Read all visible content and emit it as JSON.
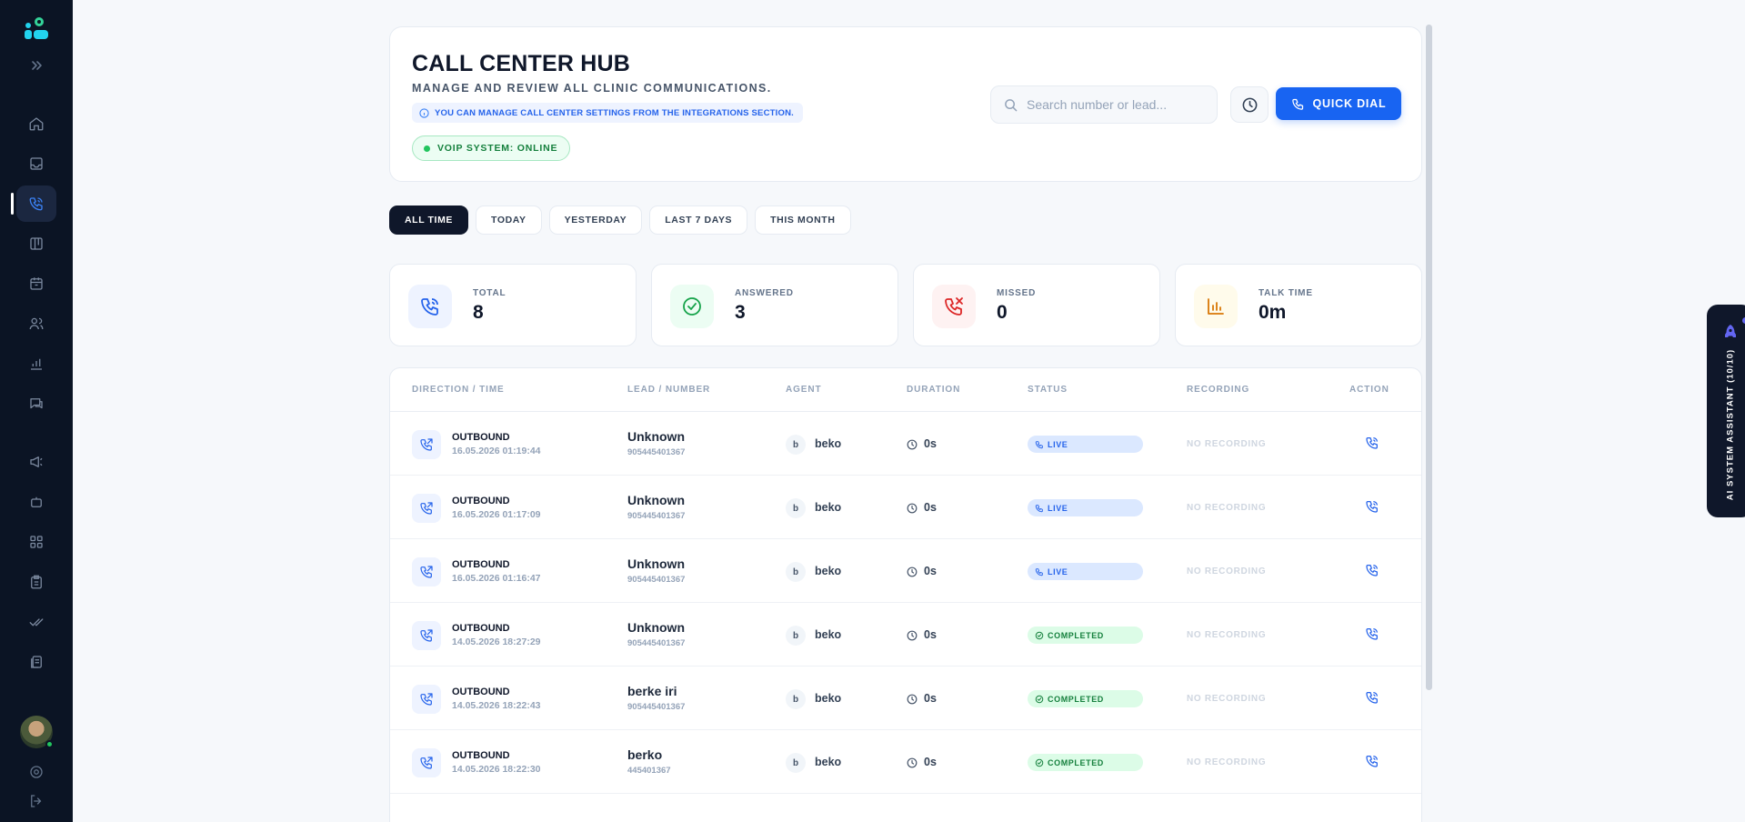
{
  "header": {
    "title": "CALL CENTER HUB",
    "subtitle": "MANAGE AND REVIEW ALL CLINIC COMMUNICATIONS.",
    "info": "YOU CAN MANAGE CALL CENTER SETTINGS FROM THE INTEGRATIONS SECTION.",
    "status": "VOIP SYSTEM: ONLINE",
    "search_placeholder": "Search number or lead...",
    "quick_dial": "QUICK DIAL"
  },
  "tabs": [
    "ALL TIME",
    "TODAY",
    "YESTERDAY",
    "LAST 7 DAYS",
    "THIS MONTH"
  ],
  "active_tab": "ALL TIME",
  "stats": [
    {
      "label": "TOTAL",
      "value": "8",
      "icon": "phone-call-icon",
      "color": "#2563eb"
    },
    {
      "label": "ANSWERED",
      "value": "3",
      "icon": "check-circle-icon",
      "color": "#16a34a"
    },
    {
      "label": "MISSED",
      "value": "0",
      "icon": "phone-missed-icon",
      "color": "#dc2626"
    },
    {
      "label": "TALK TIME",
      "value": "0m",
      "icon": "bar-chart-icon",
      "color": "#d97706"
    }
  ],
  "table": {
    "headers": [
      "DIRECTION / TIME",
      "LEAD / NUMBER",
      "AGENT",
      "DURATION",
      "STATUS",
      "RECORDING",
      "ACTION"
    ],
    "rows": [
      {
        "direction": "OUTBOUND",
        "time": "16.05.2026 01:19:44",
        "lead": "Unknown",
        "number": "905445401367",
        "agent_initial": "b",
        "agent": "beko",
        "duration": "0s",
        "status": "LIVE",
        "status_type": "live",
        "recording": "NO RECORDING"
      },
      {
        "direction": "OUTBOUND",
        "time": "16.05.2026 01:17:09",
        "lead": "Unknown",
        "number": "905445401367",
        "agent_initial": "b",
        "agent": "beko",
        "duration": "0s",
        "status": "LIVE",
        "status_type": "live",
        "recording": "NO RECORDING"
      },
      {
        "direction": "OUTBOUND",
        "time": "16.05.2026 01:16:47",
        "lead": "Unknown",
        "number": "905445401367",
        "agent_initial": "b",
        "agent": "beko",
        "duration": "0s",
        "status": "LIVE",
        "status_type": "live",
        "recording": "NO RECORDING"
      },
      {
        "direction": "OUTBOUND",
        "time": "14.05.2026 18:27:29",
        "lead": "Unknown",
        "number": "905445401367",
        "agent_initial": "b",
        "agent": "beko",
        "duration": "0s",
        "status": "COMPLETED",
        "status_type": "completed",
        "recording": "NO RECORDING"
      },
      {
        "direction": "OUTBOUND",
        "time": "14.05.2026 18:22:43",
        "lead": "berke iri",
        "number": "905445401367",
        "agent_initial": "b",
        "agent": "beko",
        "duration": "0s",
        "status": "COMPLETED",
        "status_type": "completed",
        "recording": "NO RECORDING"
      },
      {
        "direction": "OUTBOUND",
        "time": "14.05.2026 18:22:30",
        "lead": "berko",
        "number": "445401367",
        "agent_initial": "b",
        "agent": "beko",
        "duration": "0s",
        "status": "COMPLETED",
        "status_type": "completed",
        "recording": "NO RECORDING"
      }
    ]
  },
  "sidebar": {
    "items": [
      "home-icon",
      "inbox-icon",
      "phone-icon",
      "kanban-icon",
      "calendar-icon",
      "users-icon",
      "analytics-icon",
      "chat-icon",
      "megaphone-icon",
      "bot-icon",
      "apps-icon",
      "clipboard-icon",
      "check-double-icon",
      "documents-icon"
    ],
    "active": "phone-icon"
  },
  "ai_assistant": {
    "label": "AI SYSTEM ASSISTANT (10/10)"
  },
  "colors": {
    "accent": "#1864f2",
    "sidebar_bg": "#0b1424",
    "live": "#2563eb",
    "completed": "#15803d"
  }
}
